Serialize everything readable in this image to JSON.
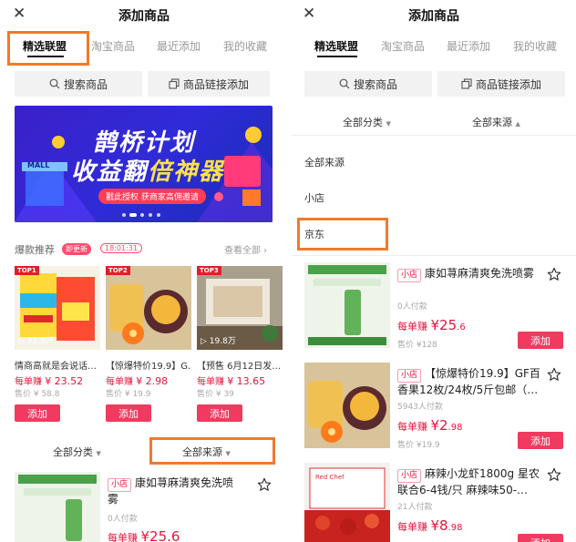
{
  "left": {
    "title": "添加商品",
    "tabs": [
      "精选联盟",
      "淘宝商品",
      "最近添加",
      "我的收藏"
    ],
    "search_label": "搜索商品",
    "link_label": "商品链接添加",
    "banner": {
      "line1": "鹊桥计划",
      "line2a": "收益翻",
      "line2b": "倍神器",
      "mall": "MALL",
      "cta": "戳此授权 获商家高佣邀请"
    },
    "hot": {
      "label": "爆款推荐",
      "badge": "即更新",
      "timer": "18:01:31",
      "see_all": "查看全部"
    },
    "grid": [
      {
        "badge": "TOP1",
        "views": "32.9万",
        "name": "情商高就是会说话…",
        "earn_label": "每单赚",
        "earn": "¥ 23.52",
        "price": "售价 ¥ 58.8",
        "add": "添加"
      },
      {
        "badge": "TOP2",
        "views": "",
        "name": "【惊爆特价19.9】G…",
        "earn_label": "每单赚",
        "earn": "¥ 2.98",
        "price": "售价 ¥ 19.9",
        "add": "添加"
      },
      {
        "badge": "TOP3",
        "views": "19.8万",
        "name": "【预售 6月12日发…",
        "earn_label": "每单赚",
        "earn": "¥ 13.65",
        "price": "售价 ¥ 39",
        "add": "添加"
      }
    ],
    "filter_category": "全部分类",
    "filter_source": "全部来源",
    "item": {
      "tag": "小店",
      "title": "康如荨麻清爽免洗喷雾",
      "buyers": "0人付款",
      "earn_label": "每单赚",
      "earn": "¥25.6"
    }
  },
  "right": {
    "title": "添加商品",
    "tabs": [
      "精选联盟",
      "淘宝商品",
      "最近添加",
      "我的收藏"
    ],
    "search_label": "搜索商品",
    "link_label": "商品链接添加",
    "filter_category": "全部分类",
    "filter_source": "全部来源",
    "source_options": [
      "全部来源",
      "小店",
      "京东"
    ],
    "items": [
      {
        "tag": "小店",
        "title": "康如荨麻清爽免洗喷雾",
        "buyers": "0人付款",
        "earn_label": "每单赚",
        "earn_big": "¥25",
        "earn_small": ".6",
        "price": "售价 ¥128",
        "add": "添加"
      },
      {
        "tag": "小店",
        "title": "【惊爆特价19.9】GF百香果12枚/24枚/5斤包邮（…",
        "buyers": "5943人付款",
        "earn_label": "每单赚",
        "earn_big": "¥2",
        "earn_small": ".98",
        "price": "售价 ¥19.9",
        "add": "添加"
      },
      {
        "tag": "小店",
        "title": "麻辣小龙虾1800g 星农联合6-4钱/只 麻辣味50-…",
        "buyers": "21人付款",
        "earn_label": "每单赚",
        "earn_big": "¥8",
        "earn_small": ".98",
        "price": "",
        "add": "添加"
      }
    ]
  },
  "colors": {
    "accent": "#f03a5f",
    "highlight_box": "#f07a2b",
    "banner_bg": "#2f2bd8"
  }
}
